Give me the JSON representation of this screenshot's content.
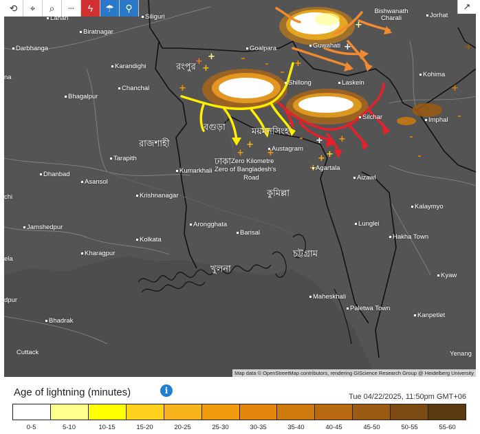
{
  "toolbar": {
    "icons": [
      "refresh-icon",
      "location-icon",
      "zoom-icon",
      "measure-icon",
      "lightning-icon",
      "weather-icon",
      "bike-icon"
    ]
  },
  "map": {
    "cities": [
      {
        "name": "Lahan"
      },
      {
        "name": "Siliguri"
      },
      {
        "name": "Biratnagar"
      },
      {
        "name": "Darbhanga"
      },
      {
        "name": "Goalpara"
      },
      {
        "name": "Guwahati"
      },
      {
        "name": "Bishwanath Charali"
      },
      {
        "name": "Jorhat"
      },
      {
        "name": "Kohima"
      },
      {
        "name": "Karandighi"
      },
      {
        "name": "Chanchal"
      },
      {
        "name": "Bhagalpur"
      },
      {
        "name": "Shillong"
      },
      {
        "name": "Laskein"
      },
      {
        "name": "Silchar"
      },
      {
        "name": "Imphal"
      },
      {
        "name": "Zero Kilometre"
      },
      {
        "name": "Zero of Bangladesh's"
      },
      {
        "name": "Road"
      },
      {
        "name": "Tarapith"
      },
      {
        "name": "Kumarkhali"
      },
      {
        "name": "Austagram"
      },
      {
        "name": "Agartala"
      },
      {
        "name": "Aizawl"
      },
      {
        "name": "Dhanbad"
      },
      {
        "name": "Asansol"
      },
      {
        "name": "Krishnanagar"
      },
      {
        "name": "Kalaymyo"
      },
      {
        "name": "Jamshedpur"
      },
      {
        "name": "Arongghata"
      },
      {
        "name": "Barisal"
      },
      {
        "name": "Lunglei"
      },
      {
        "name": "Kolkata"
      },
      {
        "name": "Hakha Town"
      },
      {
        "name": "Kharagpur"
      },
      {
        "name": "Kyaw"
      },
      {
        "name": "Maheskhali"
      },
      {
        "name": "Paletwa Town"
      },
      {
        "name": "Kanpetlet"
      },
      {
        "name": "Bhadrak"
      },
      {
        "name": "Cuttack"
      },
      {
        "name": "Yenang"
      },
      {
        "name": "na"
      },
      {
        "name": "chi"
      },
      {
        "name": "ela"
      },
      {
        "name": "dpur"
      }
    ],
    "bengali_labels": [
      "রংপুর",
      "বগুড়া",
      "ময়মনসিংহ",
      "রাজশাহী",
      "ঢাকা",
      "কুমিল্লা",
      "চট্টগ্রাম",
      "খুলনা"
    ],
    "attribution": "Map data © OpenStreetMap contributors, rendering GIScience Research Group @ Heidelberg University"
  },
  "legend": {
    "title": "Age of lightning (minutes)",
    "info_icon": "info-icon",
    "timestamp": "Tue 04/22/2025, 11:50pm GMT+06",
    "bins": [
      {
        "label": "0-5",
        "color": "#ffffff"
      },
      {
        "label": "5-10",
        "color": "#ffff8c"
      },
      {
        "label": "10-15",
        "color": "#ffff00"
      },
      {
        "label": "15-20",
        "color": "#ffd21e"
      },
      {
        "label": "20-25",
        "color": "#f7b41c"
      },
      {
        "label": "25-30",
        "color": "#f09a0e"
      },
      {
        "label": "30-35",
        "color": "#e3880c"
      },
      {
        "label": "35-40",
        "color": "#cf7a0e"
      },
      {
        "label": "40-45",
        "color": "#b86a10"
      },
      {
        "label": "45-50",
        "color": "#9a5a12"
      },
      {
        "label": "50-55",
        "color": "#7a4a12"
      },
      {
        "label": "55-60",
        "color": "#5c3a10"
      }
    ]
  },
  "annotations": {
    "arrow_colors": {
      "orange": "#f28a30",
      "yellow": "#ffee00",
      "red": "#e8202a"
    }
  }
}
